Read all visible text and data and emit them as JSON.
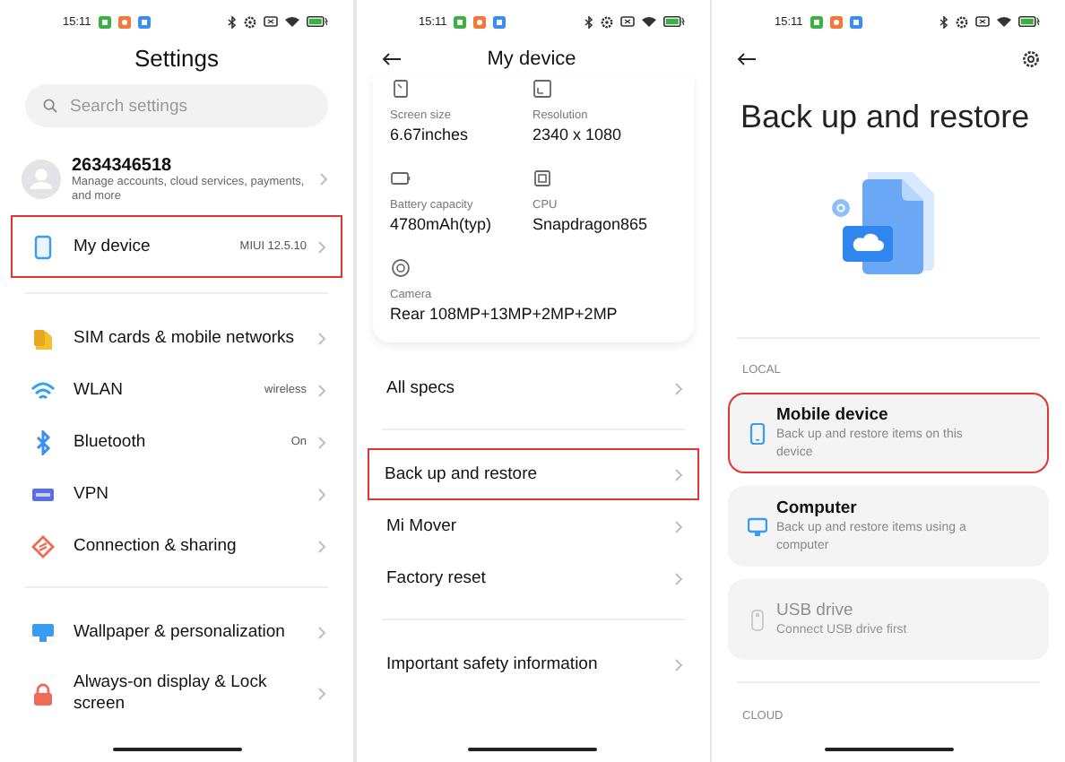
{
  "settings_screen": {
    "status_time": "15:11",
    "title": "Settings",
    "search": {
      "placeholder": "Search settings"
    },
    "account": {
      "title": "2634346518",
      "subtitle": "Manage accounts, cloud services, payments, and more"
    },
    "groups": [
      {
        "items": [
          {
            "label": "My device",
            "value": "MIUI 12.5.10",
            "highlighted": true
          }
        ]
      },
      {
        "items": [
          {
            "label": "SIM cards & mobile networks",
            "highlighted": false
          },
          {
            "label": "WLAN",
            "value": "wireless",
            "highlighted": false
          },
          {
            "label": "Bluetooth",
            "value": "On",
            "highlighted": false
          },
          {
            "label": "VPN",
            "highlighted": false
          },
          {
            "label": "Connection & sharing",
            "highlighted": false
          }
        ]
      },
      {
        "items": [
          {
            "label": "Wallpaper & personalization",
            "highlighted": false
          },
          {
            "label": "Always-on display & Lock screen",
            "highlighted": false
          }
        ]
      }
    ]
  },
  "my_device_screen": {
    "status_time": "15:11",
    "title": "My device",
    "specs": [
      {
        "label": "Screen size",
        "value": "6.67inches"
      },
      {
        "label": "Resolution",
        "value": "2340 x 1080"
      },
      {
        "label": "Battery capacity",
        "value": "4780mAh(typ)"
      },
      {
        "label": "CPU",
        "value": "Snapdragon865"
      },
      {
        "label": "Camera",
        "value": "Rear 108MP+13MP+2MP+2MP"
      }
    ],
    "groups": [
      {
        "items": [
          {
            "label": "All specs",
            "highlighted": false
          }
        ]
      },
      {
        "items": [
          {
            "label": "Back up and restore",
            "highlighted": true
          },
          {
            "label": "Mi Mover",
            "highlighted": false
          },
          {
            "label": "Factory reset",
            "highlighted": false
          }
        ]
      },
      {
        "items": [
          {
            "label": "Important safety information",
            "highlighted": false
          }
        ]
      }
    ]
  },
  "backup_screen": {
    "status_time": "15:11",
    "title": "Back up and restore",
    "local_heading": "LOCAL",
    "options": [
      {
        "title": "Mobile device",
        "subtitle": "Back up and restore items on this device",
        "highlighted": true,
        "disabled": false
      },
      {
        "title": "Computer",
        "subtitle": "Back up and restore items using a computer",
        "highlighted": false,
        "disabled": false
      },
      {
        "title": "USB drive",
        "subtitle": "Connect USB drive first",
        "highlighted": false,
        "disabled": true
      }
    ],
    "cloud_heading": "CLOUD"
  }
}
